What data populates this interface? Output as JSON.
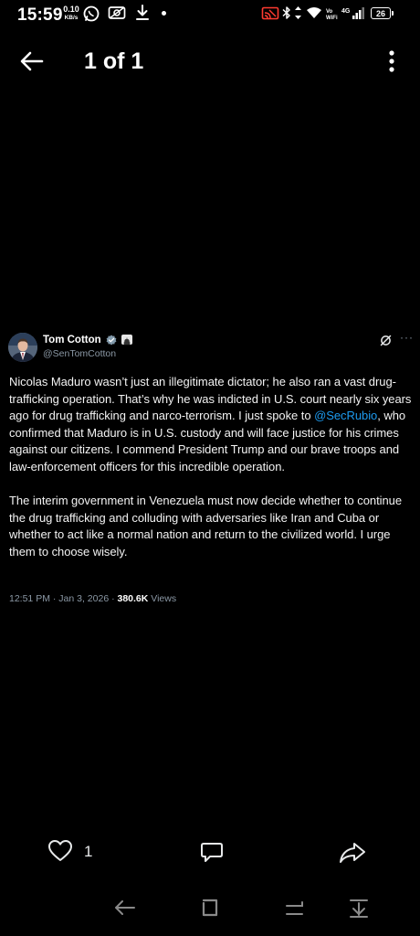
{
  "status_bar": {
    "time": "15:59",
    "net_speed_value": "0.10",
    "net_speed_unit": "KB/s",
    "battery": "26"
  },
  "header": {
    "title": "1 of 1"
  },
  "tweet": {
    "author_name": "Tom Cotton",
    "handle": "@SenTomCotton",
    "paragraph1_a": "Nicolas Maduro wasn’t just an illegitimate dictator; he also ran a vast drug-trafficking operation. That’s why he was indicted in U.S. court nearly six years ago for drug trafficking and narco-terrorism. I just spoke to ",
    "mention": "@SecRubio",
    "paragraph1_b": ", who confirmed that Maduro is in U.S. custody and will face justice for his crimes against our citizens. I commend President Trump and our brave troops and law-enforcement officers for this incredible operation.",
    "paragraph2": "The interim government in Venezuela must now decide whether to continue the drug trafficking and colluding with adversaries like Iran and Cuba or whether to act like a normal nation and return to the civilized world. I urge them to choose wisely.",
    "timestamp": "12:51 PM · Jan 3, 2026 · ",
    "views_count": "380.6K",
    "views_label": " Views"
  },
  "actions": {
    "like_count": "1"
  },
  "icons": {
    "back": "arrow-left-icon",
    "more": "more-vertical-icon",
    "like": "heart-icon",
    "reply": "comment-icon",
    "share": "share-icon"
  },
  "colors": {
    "background": "#000000",
    "link": "#1d9bf0",
    "muted": "#8b98a5"
  }
}
